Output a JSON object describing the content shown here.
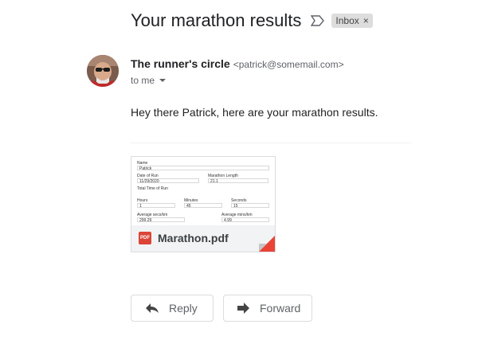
{
  "email": {
    "subject": "Your marathon results",
    "label": "Inbox",
    "label_close": "×",
    "sender_name": "The runner's circle",
    "sender_email": "<patrick@somemail.com>",
    "to": "to me",
    "body": "Hey there Patrick, here are your marathon results."
  },
  "attachment": {
    "filename": "Marathon.pdf",
    "type_badge": "PDF",
    "preview": {
      "name_label": "Name",
      "name_value": "Patrick",
      "date_label": "Date of Run",
      "date_value": "11/29/2020",
      "length_label": "Marathon Length",
      "length_value": "21.1",
      "total_label": "Total Time of Run",
      "hours_label": "Hours",
      "hours_value": "1",
      "minutes_label": "Minutes",
      "minutes_value": "45",
      "seconds_label": "Seconds",
      "seconds_value": "15",
      "avg_secs_label": "Average secs/km",
      "avg_secs_value": "299.29",
      "avg_mins_label": "Average mins/km",
      "avg_mins_value": "4.99"
    }
  },
  "actions": {
    "reply": "Reply",
    "forward": "Forward"
  },
  "icons": [
    "important-marker-icon",
    "label-close-icon",
    "caret-down-icon",
    "pdf-icon",
    "reply-icon",
    "forward-icon"
  ]
}
